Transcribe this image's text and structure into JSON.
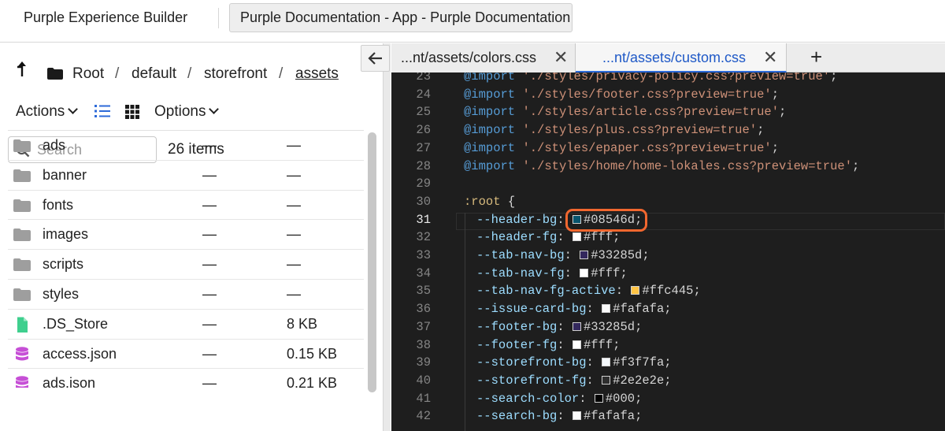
{
  "topbar": {
    "app_title": "Purple Experience Builder",
    "doc_tab_label": "Purple Documentation - App - Purple Documentation"
  },
  "browser": {
    "breadcrumb": [
      "Root",
      "default",
      "storefront",
      "assets"
    ],
    "actions_label": "Actions",
    "options_label": "Options",
    "search_placeholder": "Search",
    "item_count": "26 items",
    "items": [
      {
        "name": "ads",
        "type": "folder",
        "col2": "—",
        "col3": "—"
      },
      {
        "name": "banner",
        "type": "folder",
        "col2": "—",
        "col3": "—"
      },
      {
        "name": "fonts",
        "type": "folder",
        "col2": "—",
        "col3": "—"
      },
      {
        "name": "images",
        "type": "folder",
        "col2": "—",
        "col3": "—"
      },
      {
        "name": "scripts",
        "type": "folder",
        "col2": "—",
        "col3": "—"
      },
      {
        "name": "styles",
        "type": "folder",
        "col2": "—",
        "col3": "—"
      },
      {
        "name": ".DS_Store",
        "type": "file",
        "col2": "—",
        "col3": "8 KB"
      },
      {
        "name": "access.json",
        "type": "json",
        "col2": "—",
        "col3": "0.15 KB"
      },
      {
        "name": "ads.json",
        "type": "json",
        "col2": "—",
        "col3": "0.21 KB"
      }
    ]
  },
  "editor": {
    "tabs": [
      {
        "label": "...nt/assets/colors.css",
        "active": false
      },
      {
        "label": "...nt/assets/custom.css",
        "active": true
      }
    ],
    "active_line": 31,
    "lines": [
      {
        "n": 23,
        "kind": "import",
        "text": "'./styles/privacy-policy.css?preview=true'"
      },
      {
        "n": 24,
        "kind": "import",
        "text": "'./styles/footer.css?preview=true'"
      },
      {
        "n": 25,
        "kind": "import",
        "text": "'./styles/article.css?preview=true'"
      },
      {
        "n": 26,
        "kind": "import",
        "text": "'./styles/plus.css?preview=true'"
      },
      {
        "n": 27,
        "kind": "import",
        "text": "'./styles/epaper.css?preview=true'"
      },
      {
        "n": 28,
        "kind": "import",
        "text": "'./styles/home/home-lokales.css?preview=true'"
      },
      {
        "n": 29,
        "kind": "blank"
      },
      {
        "n": 30,
        "kind": "selector",
        "text": ":root"
      },
      {
        "n": 31,
        "kind": "var",
        "name": "--header-bg",
        "value": "#08546d"
      },
      {
        "n": 32,
        "kind": "var",
        "name": "--header-fg",
        "value": "#fff"
      },
      {
        "n": 33,
        "kind": "var",
        "name": "--tab-nav-bg",
        "value": "#33285d"
      },
      {
        "n": 34,
        "kind": "var",
        "name": "--tab-nav-fg",
        "value": "#fff"
      },
      {
        "n": 35,
        "kind": "var",
        "name": "--tab-nav-fg-active",
        "value": "#ffc445"
      },
      {
        "n": 36,
        "kind": "var",
        "name": "--issue-card-bg",
        "value": "#fafafa"
      },
      {
        "n": 37,
        "kind": "var",
        "name": "--footer-bg",
        "value": "#33285d"
      },
      {
        "n": 38,
        "kind": "var",
        "name": "--footer-fg",
        "value": "#fff"
      },
      {
        "n": 39,
        "kind": "var",
        "name": "--storefront-bg",
        "value": "#f3f7fa"
      },
      {
        "n": 40,
        "kind": "var",
        "name": "--storefront-fg",
        "value": "#2e2e2e"
      },
      {
        "n": 41,
        "kind": "var",
        "name": "--search-color",
        "value": "#000"
      },
      {
        "n": 42,
        "kind": "var",
        "name": "--search-bg",
        "value": "#fafafa"
      }
    ]
  },
  "colors": {
    "accent_blue": "#2d6ad8",
    "highlight_ring": "#f2672f",
    "editor_bg": "#1e1e1e"
  }
}
